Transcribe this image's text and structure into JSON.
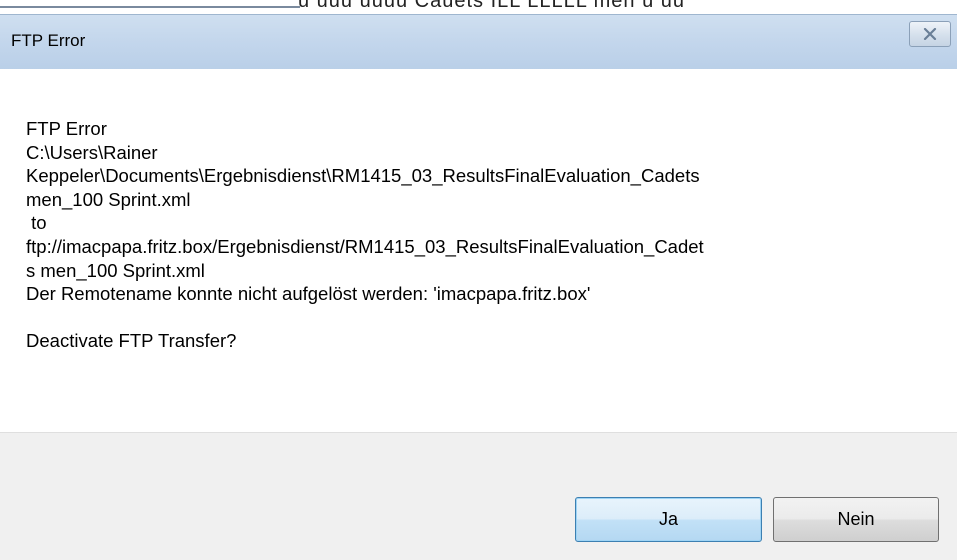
{
  "dialog": {
    "title": "FTP Error",
    "close_icon": "close-x-icon",
    "message_lines": [
      "FTP Error",
      "C:\\Users\\Rainer",
      "Keppeler\\Documents\\Ergebnisdienst\\RM1415_03_ResultsFinalEvaluation_Cadets",
      "men_100 Sprint.xml",
      " to",
      "ftp://imacpapa.fritz.box/Ergebnisdienst/RM1415_03_ResultsFinalEvaluation_Cadet",
      "s men_100 Sprint.xml",
      "Der Remotename konnte nicht aufgelöst werden: 'imacpapa.fritz.box'"
    ],
    "question": "Deactivate FTP Transfer?",
    "buttons": {
      "yes_label": "Ja",
      "no_label": "Nein"
    }
  },
  "background_window": {
    "partial_text": "u  uuu  uuuu  Cauets  ILL LLLLL  men  u  uu"
  }
}
